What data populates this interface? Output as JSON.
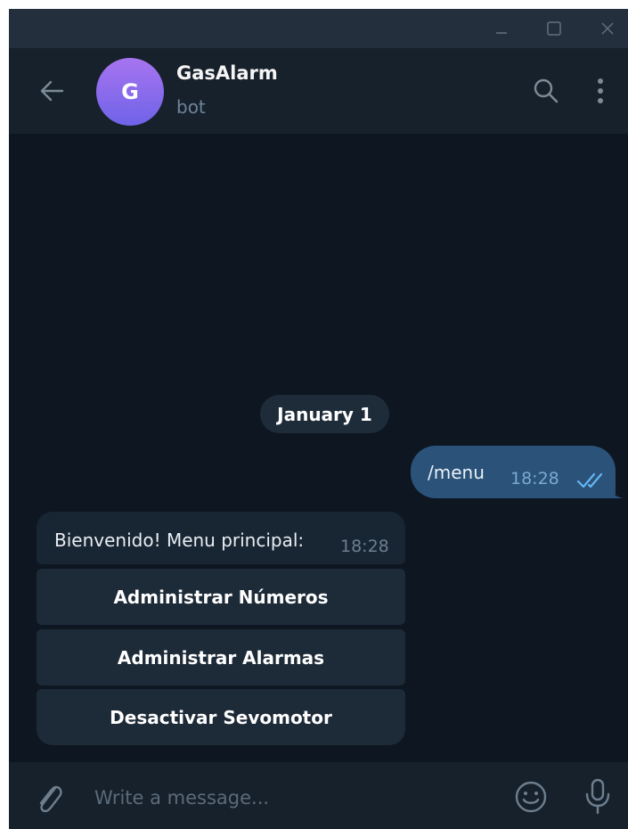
{
  "window": {
    "controls": [
      {
        "name": "minimize-button",
        "icon": "minimize-icon"
      },
      {
        "name": "maximize-button",
        "icon": "maximize-icon"
      },
      {
        "name": "close-button",
        "icon": "close-icon"
      }
    ]
  },
  "header": {
    "back_icon": "arrow-left-icon",
    "avatar_letter": "G",
    "avatar_gradient": [
      "#a774f0",
      "#6f63e8"
    ],
    "title": "GasAlarm",
    "status": "bot",
    "search_icon": "search-icon",
    "more_icon": "more-vertical-icon"
  },
  "chat": {
    "date_label": "January 1",
    "outgoing": {
      "text": "/menu",
      "time": "18:28",
      "status_icon": "double-check-icon"
    },
    "incoming": {
      "text": "Bienvenido! Menu principal:",
      "time": "18:28"
    },
    "keyboard_buttons": [
      "Administrar Números",
      "Administrar Alarmas",
      "Desactivar Sevomotor"
    ]
  },
  "composer": {
    "placeholder": "Write a message...",
    "attach_icon": "paperclip-icon",
    "emoji_icon": "smile-icon",
    "mic_icon": "microphone-icon"
  },
  "colors": {
    "background": "#0e1621",
    "header": "#17212b",
    "titlebar": "#242f3d",
    "outgoing_bubble": "#2b5278",
    "incoming_bubble": "#182533",
    "accent": "#64b5f6"
  }
}
